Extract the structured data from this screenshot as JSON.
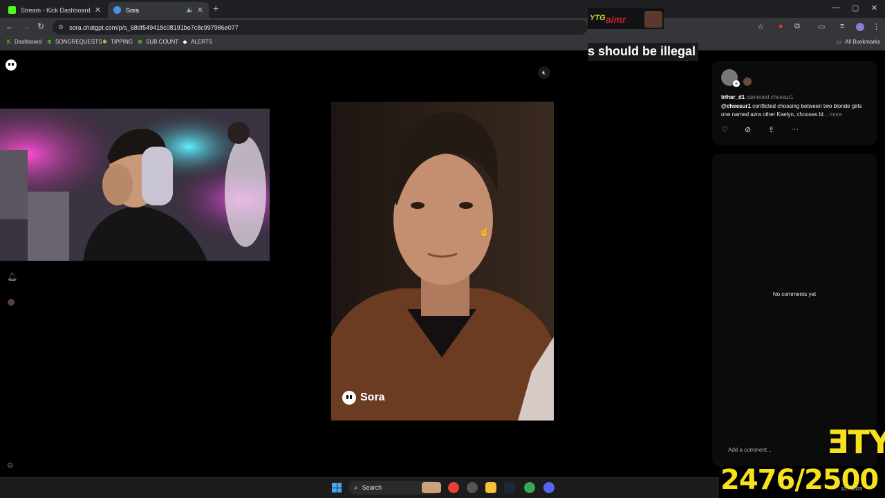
{
  "browser": {
    "tabs": [
      {
        "title": "Stream - Kick Dashboard",
        "favicon_color": "#53fc18"
      },
      {
        "title": "Sora",
        "favicon_color": "#4a90e2",
        "active": true
      }
    ],
    "new_tab_label": "+",
    "window_controls": {
      "minimize": "—",
      "maximize": "▢",
      "close": "✕"
    },
    "url": "sora.chatgpt.com/p/s_68df549418c08191be7c8c997986e077",
    "bookmarks": [
      {
        "label": "Dashboard",
        "color": "#53fc18"
      },
      {
        "label": "SONGREQUESTS",
        "color": "#53fc18"
      },
      {
        "label": "TIPPING",
        "color": "#c6d92a"
      },
      {
        "label": "SUB COUNT",
        "color": "#53fc18"
      },
      {
        "label": "ALERTS",
        "color": "#ffffff"
      }
    ],
    "all_bookmarks_label": "All Bookmarks"
  },
  "stream_overlay": {
    "chat_badge": "YTG",
    "chat_name": "aimr",
    "caption": "s should be illegal",
    "title_fragment": "ƎTY",
    "counter": "2476/2500"
  },
  "sora": {
    "watermark": "Sora",
    "mute_icon": "speaker-muted-icon",
    "post": {
      "username": "trihar_d1",
      "action_text": "cameoed cheesur1",
      "mention": "@cheesur1",
      "description": "conflicted choosing between two blonde girls one named azra other Kaelyn, chooses bl...",
      "more_label": "more"
    },
    "actions": [
      {
        "icon": "heart-icon",
        "glyph": "♡"
      },
      {
        "icon": "remix-icon",
        "glyph": "⊘"
      },
      {
        "icon": "share-icon",
        "glyph": "⇪"
      },
      {
        "icon": "more-icon",
        "glyph": "···"
      }
    ],
    "no_comments": "No comments yet",
    "comment_placeholder": "Add a comment..."
  },
  "taskbar": {
    "search_label": "Search",
    "clock_fragment": "10... 2025"
  },
  "colors": {
    "kick_green": "#53fc18",
    "overlay_yellow": "#f7e11d"
  }
}
